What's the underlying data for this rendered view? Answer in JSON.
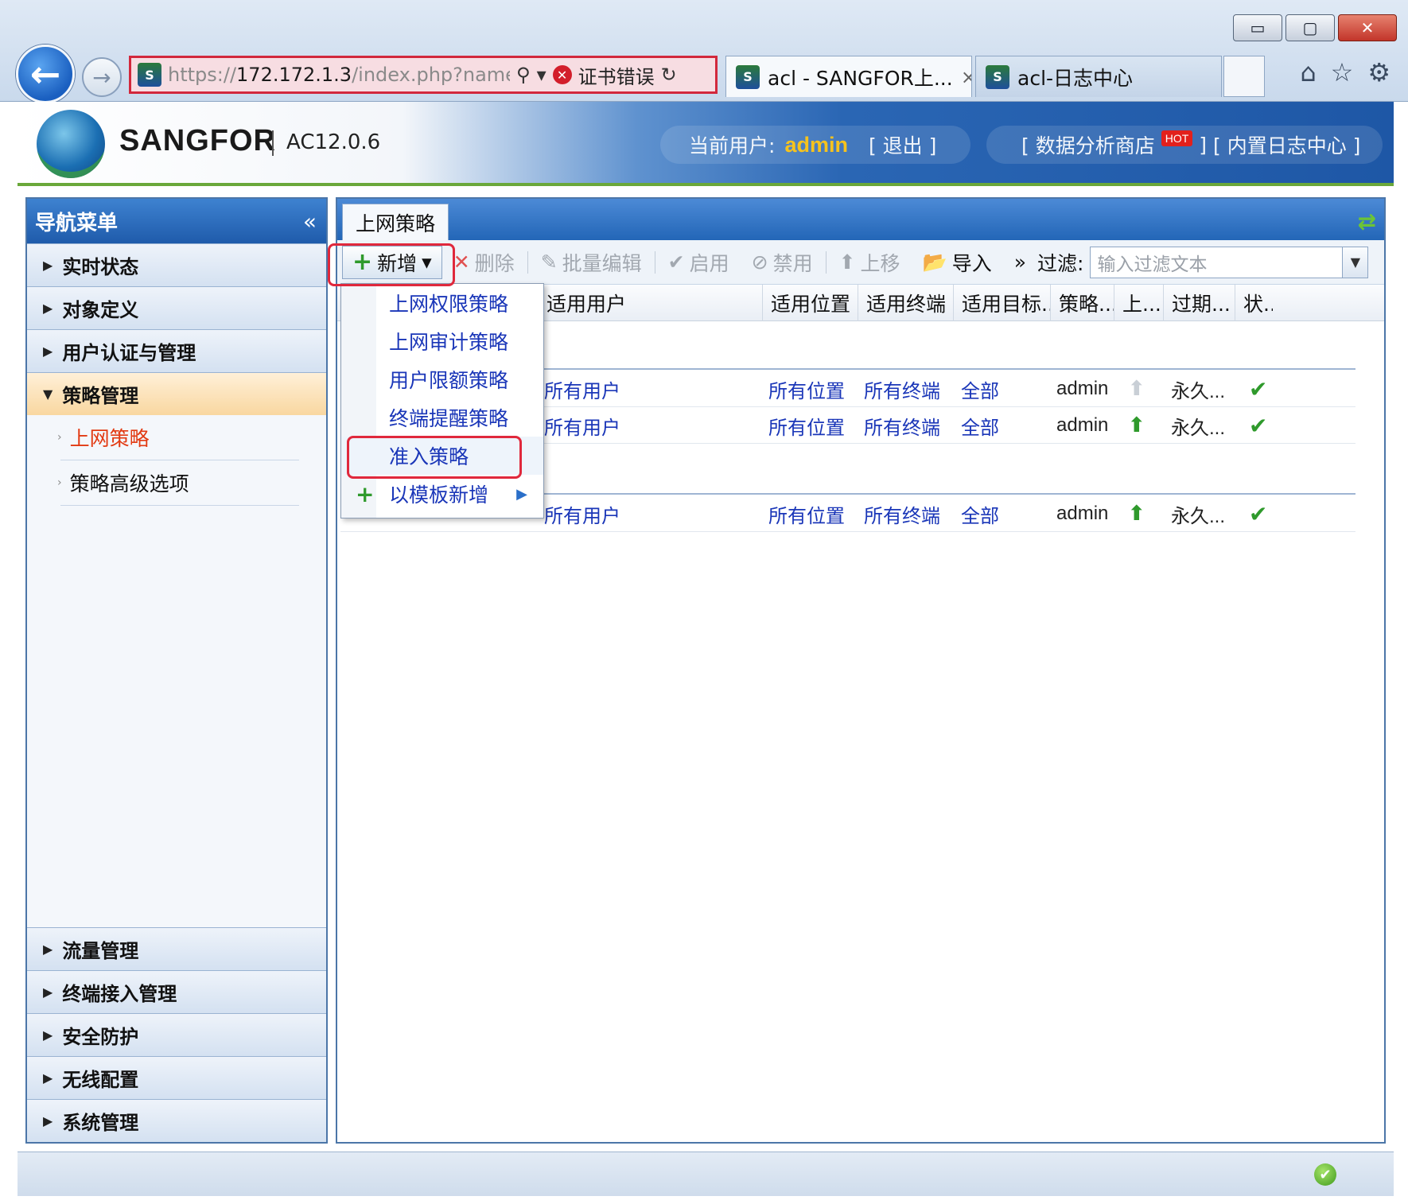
{
  "browser": {
    "back_icon": "←",
    "forward_icon": "→",
    "url_prefix": "https://",
    "url_host": "172.172.1.3",
    "url_path": "/index.php?name_j",
    "search_icon": "⚲",
    "cert_error": "证书错误",
    "refresh_icon": "↻",
    "tabs": [
      {
        "title": "acl - SANGFOR上...",
        "close": "×"
      },
      {
        "title": "acl-日志中心"
      }
    ],
    "win_min": "▭",
    "win_max": "▢",
    "win_close": "✕",
    "home_icon": "⌂",
    "star_icon": "☆",
    "gear_icon": "⚙"
  },
  "header": {
    "brand": "SANGFOR",
    "version": "AC12.0.6",
    "user_label": "当前用户:",
    "user_name": "admin",
    "logout": "[ 退出 ]",
    "data_shop": "[ 数据分析商店",
    "hot_badge": "HOT",
    "data_shop_close": "]",
    "log_center": "[ 内置日志中心 ]"
  },
  "nav": {
    "title": "导航菜单",
    "collapse_icon": "«",
    "groups_top": [
      {
        "label": "实时状态"
      },
      {
        "label": "对象定义"
      },
      {
        "label": "用户认证与管理"
      },
      {
        "label": "策略管理"
      }
    ],
    "sub_items": [
      {
        "label": "上网策略"
      },
      {
        "label": "策略高级选项"
      }
    ],
    "groups_bottom": [
      {
        "label": "流量管理"
      },
      {
        "label": "终端接入管理"
      },
      {
        "label": "安全防护"
      },
      {
        "label": "无线配置"
      },
      {
        "label": "系统管理"
      }
    ]
  },
  "main": {
    "tab_label": "上网策略",
    "toolbar": {
      "add": "新增",
      "delete": "删除",
      "batch_edit": "批量编辑",
      "enable": "启用",
      "disable": "禁用",
      "move_up": "上移",
      "import": "导入",
      "more": "»",
      "filter_label": "过滤:",
      "filter_placeholder": "输入过滤文本"
    },
    "columns": [
      "适用用户",
      "适用位置",
      "适用终端",
      "适用目标...",
      "策略...",
      "上...",
      "过期...",
      "状..."
    ],
    "rows": [
      {
        "user": "所有用户",
        "location": "所有位置",
        "terminal": "所有终端",
        "target": "全部",
        "creator": "admin",
        "expiry": "永久...",
        "up_enabled": false
      },
      {
        "user": "所有用户",
        "location": "所有位置",
        "terminal": "所有终端",
        "target": "全部",
        "creator": "admin",
        "expiry": "永久...",
        "up_enabled": true
      },
      {
        "user": "所有用户",
        "location": "所有位置",
        "terminal": "所有终端",
        "target": "全部",
        "creator": "admin",
        "expiry": "永久...",
        "up_enabled": true
      }
    ],
    "dropdown": [
      {
        "label": "上网权限策略"
      },
      {
        "label": "上网审计策略"
      },
      {
        "label": "用户限额策略"
      },
      {
        "label": "终端提醒策略"
      },
      {
        "label": "准入策略"
      },
      {
        "label": "以模板新增"
      }
    ]
  },
  "icons": {
    "tri_right": "▶",
    "tri_down": "▼",
    "sub_tri": "›",
    "plus": "+",
    "x": "✕",
    "pencil": "✎",
    "check": "✔",
    "forbid": "⊘",
    "up": "⬆",
    "import": "📂",
    "caret": "▾",
    "refresh_arrows": "⇄",
    "status_ok": "✔"
  },
  "colors": {
    "link": "#1a36b8",
    "active_nav": "#e23a12",
    "accent_green": "#2f9a2c",
    "user_name": "#f6c31d",
    "highlight_box": "#e0283c"
  }
}
